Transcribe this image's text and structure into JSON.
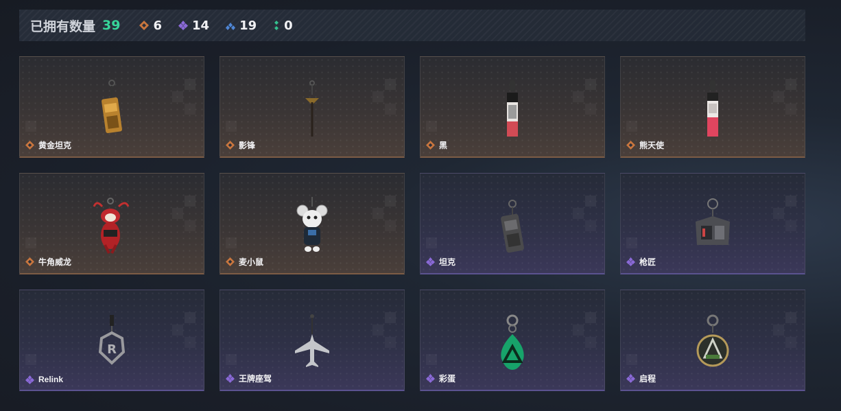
{
  "header": {
    "title": "已拥有数量",
    "total": "39",
    "stats": [
      {
        "icon": "orange-rarity-diamond-icon",
        "color": "#c9763e",
        "value": "6"
      },
      {
        "icon": "purple-rarity-diamond-icon",
        "color": "#8b6ad8",
        "value": "14"
      },
      {
        "icon": "blue-rarity-icon",
        "color": "#4f86d6",
        "value": "19"
      },
      {
        "icon": "green-rarity-icon",
        "color": "#34c08e",
        "value": "0"
      }
    ]
  },
  "colors": {
    "orange": "#c9763e",
    "purple": "#8b6ad8",
    "accent_green": "#37d59a"
  },
  "items": [
    {
      "name": "黄金坦克",
      "rarity": "orange",
      "icon": "golden-tank-charm-icon"
    },
    {
      "name": "影锋",
      "rarity": "orange",
      "icon": "shadow-blade-charm-icon"
    },
    {
      "name": "黑",
      "rarity": "orange",
      "icon": "black-tag-charm-icon"
    },
    {
      "name": "熊天使",
      "rarity": "orange",
      "icon": "bear-angel-tag-charm-icon"
    },
    {
      "name": "牛角威龙",
      "rarity": "orange",
      "icon": "horned-dragon-charm-icon"
    },
    {
      "name": "麦小鼠",
      "rarity": "orange",
      "icon": "mouse-charm-icon"
    },
    {
      "name": "坦克",
      "rarity": "purple",
      "icon": "tank-charm-icon"
    },
    {
      "name": "枪匠",
      "rarity": "purple",
      "icon": "gunsmith-charm-icon"
    },
    {
      "name": "Relink",
      "rarity": "purple",
      "icon": "relink-charm-icon"
    },
    {
      "name": "王牌座驾",
      "rarity": "purple",
      "icon": "jet-plane-charm-icon"
    },
    {
      "name": "彩蛋",
      "rarity": "purple",
      "icon": "easter-egg-charm-icon"
    },
    {
      "name": "启程",
      "rarity": "purple",
      "icon": "departure-medal-charm-icon"
    }
  ]
}
